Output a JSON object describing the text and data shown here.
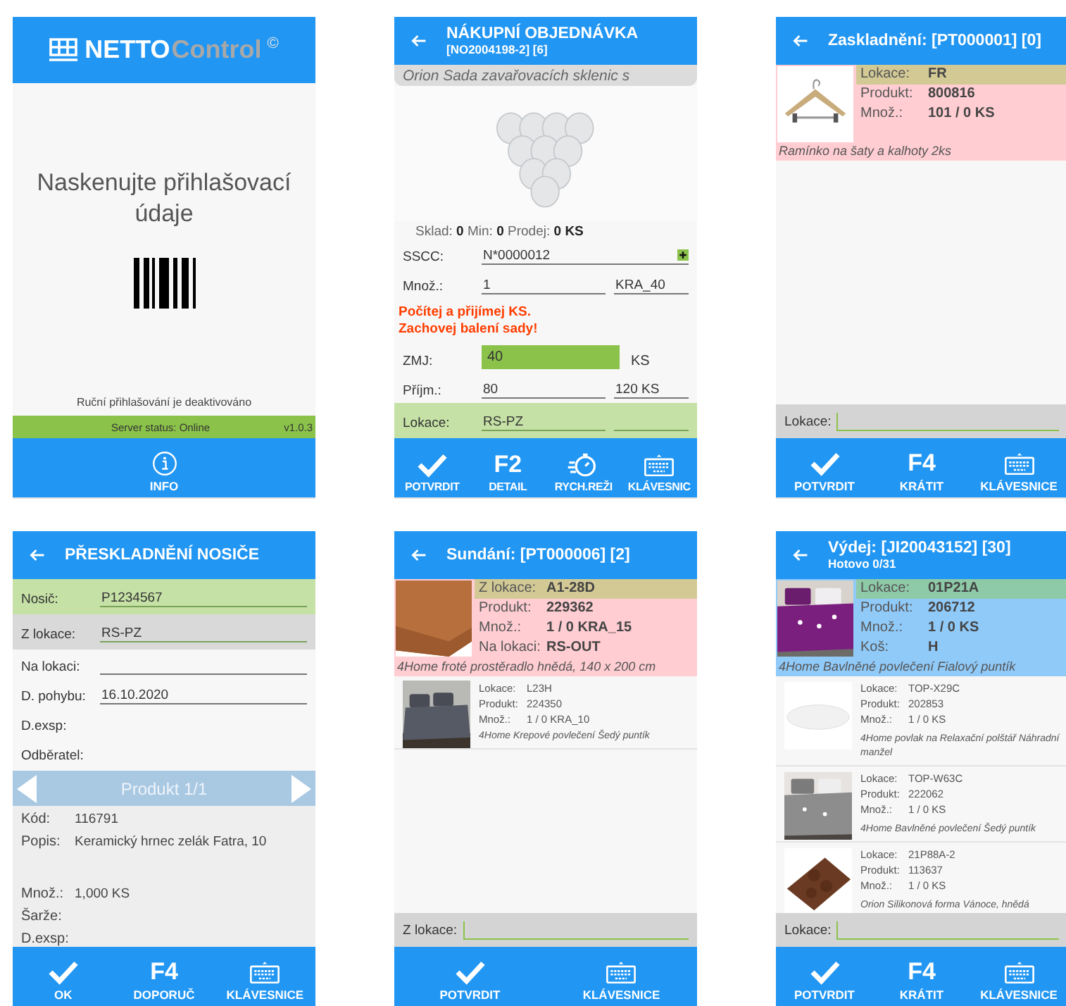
{
  "screens": [
    {
      "header": {
        "kind": "logo",
        "parts": [
          "NETTO",
          "Control",
          "©"
        ]
      },
      "sections": [
        {
          "kind": "message",
          "text": "Naskenujte přihlašovací údaje"
        },
        {
          "kind": "barcode"
        },
        {
          "kind": "note",
          "text": "Ruční přihlašování je deaktivováno"
        },
        {
          "kind": "status",
          "text": "Server status: Online",
          "version": "v1.0.3"
        }
      ],
      "buttons": [
        {
          "kind": "info",
          "label": "INFO"
        }
      ]
    },
    {
      "header": {
        "kind": "back",
        "title": "NÁKUPNÍ OBJEDNÁVKA",
        "subtitle": "[NO2004198-2] [6]"
      },
      "sections": [
        {
          "kind": "title-bar",
          "text": "Orion Sada zavařovacích sklenic s"
        },
        {
          "kind": "picture"
        },
        {
          "kind": "stock",
          "text": "Sklad: **0** Min: **0** Prodej: **0 KS**"
        },
        {
          "kind": "form",
          "rows": [
            {
              "kind": "input-add",
              "label": "SSCC:",
              "value": "N*0000012"
            },
            {
              "kind": "input-pair",
              "label": "Množ.:",
              "value": "1",
              "value2": "KRA_40"
            }
          ]
        },
        {
          "kind": "warning",
          "lines": [
            "Počítej a přijímej KS.",
            "Zachovej balení sady!"
          ]
        },
        {
          "kind": "form",
          "rows": [
            {
              "kind": "filled",
              "label": "ZMJ:",
              "value": "40",
              "unit": "KS"
            },
            {
              "kind": "input-pair",
              "label": "Příjm.:",
              "value": "80",
              "value2": "120 KS"
            },
            {
              "kind": "input-pair",
              "label": "Lokace:",
              "value": "RS-PZ",
              "color": "#c5e1a5"
            }
          ]
        }
      ],
      "buttons": [
        {
          "kind": "check",
          "label": "POTVRDIT"
        },
        {
          "kind": "key",
          "key": "F2",
          "label": "DETAIL"
        },
        {
          "kind": "timer",
          "label": "RYCH.REŽI"
        },
        {
          "kind": "keyboard",
          "label": "KLÁVESNIC"
        }
      ]
    },
    {
      "header": {
        "kind": "back",
        "title": "Zaskladnění: [PT000001] [0]"
      },
      "sections": [
        {
          "kind": "items",
          "items": [
            {
              "selected": true,
              "color": "#ffcdd2",
              "fields": [
                {
                  "label": "Lokace:",
                  "value": "FR",
                  "color": "#d2c995"
                },
                {
                  "label": "Produkt:",
                  "value": "800816"
                },
                {
                  "label": "Množ.:",
                  "value": "101 / 0 KS"
                }
              ],
              "description": "Ramínko na šaty a kalhoty 2ks"
            }
          ]
        },
        {
          "kind": "bottom-field",
          "label": "Lokace:"
        }
      ],
      "buttons": [
        {
          "kind": "check",
          "label": "POTVRDIT"
        },
        {
          "kind": "key",
          "key": "F4",
          "label": "KRÁTIT"
        },
        {
          "kind": "keyboard",
          "label": "KLÁVESNICE"
        }
      ]
    },
    {
      "header": {
        "kind": "back",
        "title": "PŘESKLADNĚNÍ NOSIČE"
      },
      "sections": [
        {
          "kind": "form",
          "rows": [
            {
              "kind": "input",
              "label": "Nosič:",
              "value": "P1234567",
              "color": "#c5e1a5"
            },
            {
              "kind": "input",
              "label": "Z lokace:",
              "value": "RS-PZ",
              "color": "#d9d9d9"
            },
            {
              "kind": "input",
              "label": "Na lokaci:"
            },
            {
              "kind": "input",
              "label": "D. pohybu:",
              "value": "16.10.2020"
            },
            {
              "kind": "plain",
              "label": "D.exsp:"
            },
            {
              "kind": "plain",
              "label": "Odběratel:"
            }
          ]
        },
        {
          "kind": "pager",
          "text": "Produkt 1/1"
        },
        {
          "kind": "details",
          "rows": [
            {
              "label": "Kód:",
              "value": "116791"
            },
            {
              "label": "Popis:",
              "value": "Keramický hrnec zelák Fatra, 10"
            }
          ]
        },
        {
          "kind": "details",
          "rows": [
            {
              "label": "Množ.:",
              "value": "1,000 KS"
            },
            {
              "label": "Šarže:"
            },
            {
              "label": "D.exsp:"
            }
          ]
        }
      ],
      "buttons": [
        {
          "kind": "check",
          "label": "OK"
        },
        {
          "kind": "key",
          "key": "F4",
          "label": "DOPORUČ"
        },
        {
          "kind": "keyboard",
          "label": "KLÁVESNICE"
        }
      ]
    },
    {
      "header": {
        "kind": "back",
        "title": "Sundání: [PT000006] [2]"
      },
      "sections": [
        {
          "kind": "items",
          "items": [
            {
              "selected": true,
              "color": "#ffcdd2",
              "fields": [
                {
                  "label": "Z lokace:",
                  "value": "A1-28D",
                  "color": "#d2c995"
                },
                {
                  "label": "Produkt:",
                  "value": "229362"
                },
                {
                  "label": "Množ.:",
                  "value": "1 / 0 KRA_15"
                },
                {
                  "label": "Na lokaci:",
                  "value": "RS-OUT"
                }
              ],
              "description": "4Home froté prostěradlo hnědá, 140 x 200 cm"
            },
            {
              "selected": false,
              "fields": [
                {
                  "label": "Lokace:",
                  "value": "L23H"
                },
                {
                  "label": "Produkt:",
                  "value": "224350"
                },
                {
                  "label": "Množ.:",
                  "value": "1 / 0 KRA_10"
                }
              ],
              "description": "4Home Krepové povlečení Šedý puntík"
            }
          ]
        },
        {
          "kind": "bottom-field",
          "label": "Z lokace:"
        }
      ],
      "buttons": [
        {
          "kind": "check",
          "label": "POTVRDIT"
        },
        {
          "kind": "keyboard",
          "label": "KLÁVESNICE"
        }
      ]
    },
    {
      "header": {
        "kind": "back",
        "title": "Výdej: [JI20043152] [30]",
        "subtitle": "Hotovo 0/31"
      },
      "sections": [
        {
          "kind": "items",
          "items": [
            {
              "selected": true,
              "color": "#90caf9",
              "fields": [
                {
                  "label": "Lokace:",
                  "value": "01P21A",
                  "color": "#8fcaa8"
                },
                {
                  "label": "Produkt:",
                  "value": "206712"
                },
                {
                  "label": "Množ.:",
                  "value": "1 / 0 KS"
                },
                {
                  "label": "Koš:",
                  "value": "H"
                }
              ],
              "description": "4Home Bavlněné povlečení Fialový puntík"
            },
            {
              "selected": false,
              "fields": [
                {
                  "label": "Lokace:",
                  "value": "TOP-X29C"
                },
                {
                  "label": "Produkt:",
                  "value": "202853"
                },
                {
                  "label": "Množ.:",
                  "value": "1 / 0 KS"
                }
              ],
              "description": "4Home povlak na Relaxační polštář Náhradní manžel"
            },
            {
              "selected": false,
              "fields": [
                {
                  "label": "Lokace:",
                  "value": "TOP-W63C"
                },
                {
                  "label": "Produkt:",
                  "value": "222062"
                },
                {
                  "label": "Množ.:",
                  "value": "1 / 0 KS"
                }
              ],
              "description": "4Home Bavlněné povlečení Šedý puntík"
            },
            {
              "selected": false,
              "fields": [
                {
                  "label": "Lokace:",
                  "value": "21P88A-2"
                },
                {
                  "label": "Produkt:",
                  "value": "113637"
                },
                {
                  "label": "Množ.:",
                  "value": "1 / 0 KS"
                }
              ],
              "description": "Orion Silikonová forma Vánoce, hnědá"
            }
          ]
        },
        {
          "kind": "bottom-field",
          "label": "Lokace:"
        }
      ],
      "buttons": [
        {
          "kind": "check",
          "label": "POTVRDIT"
        },
        {
          "kind": "key",
          "key": "F4",
          "label": "KRÁTIT"
        },
        {
          "kind": "keyboard",
          "label": "KLÁVESNICE"
        }
      ]
    }
  ]
}
